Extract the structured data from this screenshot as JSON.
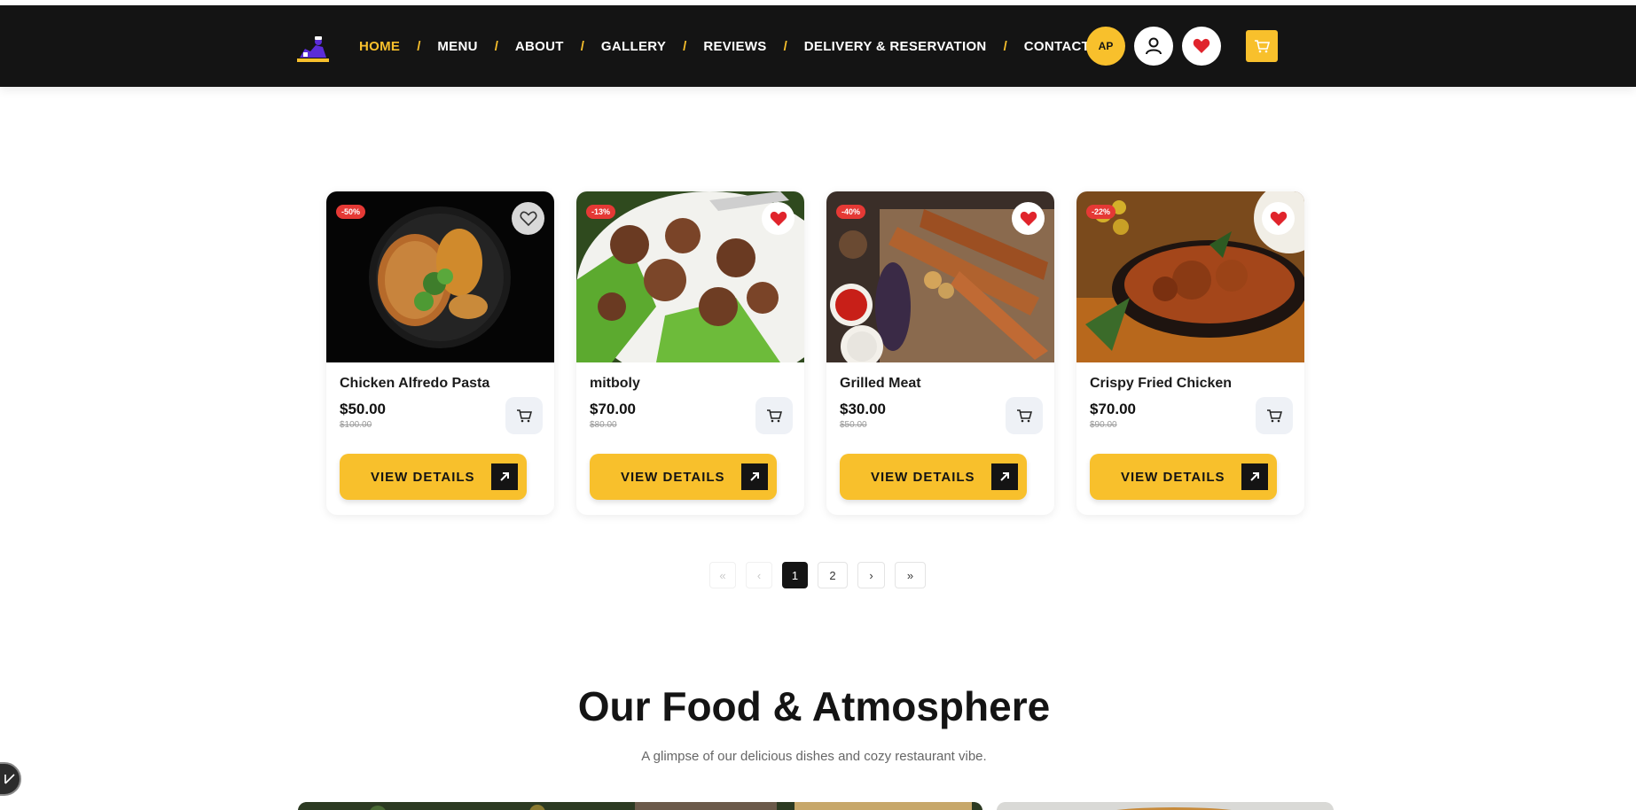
{
  "nav": {
    "items": [
      {
        "label": "HOME",
        "active": true
      },
      {
        "label": "MENU",
        "active": false
      },
      {
        "label": "ABOUT",
        "active": false
      },
      {
        "label": "GALLERY",
        "active": false
      },
      {
        "label": "REVIEWS",
        "active": false
      },
      {
        "label": "DELIVERY & RESERVATION",
        "active": false
      },
      {
        "label": "CONTACT",
        "active": false
      }
    ],
    "separator": "/",
    "avatar_initials": "AP",
    "icons": [
      "chef-logo-icon",
      "user-icon",
      "heart-icon",
      "cart-icon"
    ]
  },
  "products": [
    {
      "name": "Chicken Alfredo Pasta",
      "price": "$50.00",
      "old_price": "$100.00",
      "discount": "-50%",
      "favorite": false,
      "image": "pasta-with-chicken-and-broccoli",
      "button": "VIEW DETAILS"
    },
    {
      "name": "mitboly",
      "price": "$70.00",
      "old_price": "$80.00",
      "discount": "-13%",
      "favorite": true,
      "image": "meatballs-on-greens",
      "button": "VIEW DETAILS"
    },
    {
      "name": "Grilled Meat",
      "price": "$30.00",
      "old_price": "$50.00",
      "discount": "-40%",
      "favorite": true,
      "image": "grilled-skewers-and-potatoes",
      "button": "VIEW DETAILS"
    },
    {
      "name": "Crispy Fried Chicken",
      "price": "$70.00",
      "old_price": "$90.00",
      "discount": "-22%",
      "favorite": true,
      "image": "chicken-curry-in-bowl",
      "button": "VIEW DETAILS"
    }
  ],
  "pagination": {
    "first": "«",
    "prev": "‹",
    "pages": [
      "1",
      "2"
    ],
    "current": "1",
    "next": "›",
    "last": "»"
  },
  "section": {
    "title": "Our Food & Atmosphere",
    "subtitle": "A glimpse of our delicious dishes and cozy restaurant vibe."
  },
  "colors": {
    "nav_bg": "#141414",
    "accent": "#f8c02c",
    "badge": "#e53935",
    "heart": "#e0242c"
  }
}
